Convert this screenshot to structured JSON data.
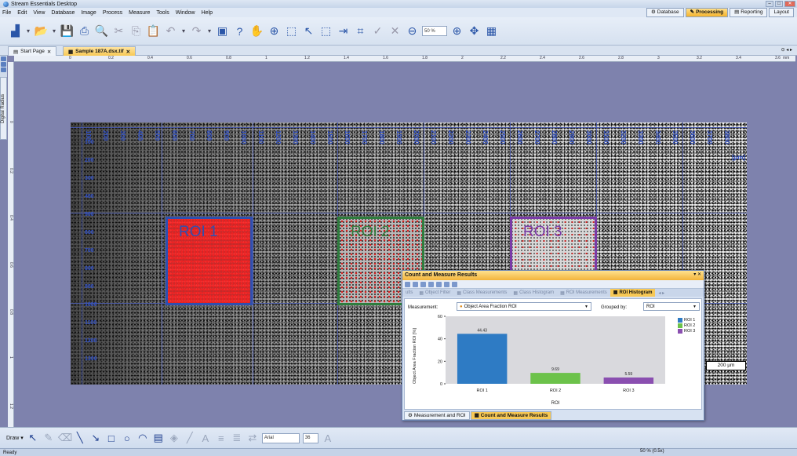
{
  "window": {
    "title": "Stream Essentials Desktop"
  },
  "menu": [
    "File",
    "Edit",
    "View",
    "Database",
    "Image",
    "Process",
    "Measure",
    "Tools",
    "Window",
    "Help"
  ],
  "modes": [
    {
      "label": "Database",
      "active": false
    },
    {
      "label": "Processing",
      "active": true
    },
    {
      "label": "Reporting",
      "active": false
    },
    {
      "label": "Layout",
      "active": false
    }
  ],
  "toolbar": {
    "zoom_value": "50 %"
  },
  "tabs": [
    {
      "label": "Start Page",
      "active": false
    },
    {
      "label": "Sample 187A.dsx.tif",
      "active": true
    }
  ],
  "side_panel": {
    "label": "Digital Radius"
  },
  "ruler_h": {
    "labels": [
      "0",
      "0.2",
      "0.4",
      "0.6",
      "0.8",
      "1",
      "1.2",
      "1.4",
      "1.6",
      "1.8",
      "2",
      "2.2",
      "2.4",
      "2.6",
      "2.8",
      "3",
      "3.2",
      "3.4",
      "3.6",
      "3.8"
    ],
    "unit": "mm"
  },
  "ruler_v": {
    "labels": [
      "0",
      "0.2",
      "0.4",
      "0.6",
      "0.8",
      "1",
      "1.2"
    ]
  },
  "image": {
    "h_marks": [
      "100",
      "200",
      "300",
      "400",
      "500",
      "600",
      "700",
      "800",
      "900",
      "1000",
      "1100",
      "1200",
      "1300",
      "1400",
      "1500",
      "1600",
      "1700",
      "1800",
      "1900",
      "2000",
      "2100",
      "2200",
      "2300",
      "2400",
      "2500",
      "2600",
      "2700",
      "2800",
      "2900",
      "3000",
      "3100",
      "3200",
      "3300",
      "3400",
      "3500",
      "3600",
      "3700",
      "3800"
    ],
    "v_marks": [
      "100",
      "200",
      "300",
      "400",
      "500",
      "600",
      "700",
      "800",
      "900",
      "1000",
      "1100",
      "1200",
      "1300"
    ],
    "unit_label": "[µm]",
    "scale_bar": "200 µm",
    "rois": [
      {
        "label": "ROI 1",
        "color": "#2f4fb0"
      },
      {
        "label": "ROI 2",
        "color": "#2e7d3e"
      },
      {
        "label": "ROI 3",
        "color": "#7a3aa8"
      }
    ]
  },
  "results_panel": {
    "title": "Count and Measure Results",
    "controls": "▾ ✕",
    "tabs": [
      {
        "label": "ults",
        "active": false
      },
      {
        "label": "Object Filter",
        "active": false
      },
      {
        "label": "Class Measurements",
        "active": false
      },
      {
        "label": "Class Histogram",
        "active": false
      },
      {
        "label": "ROI Measurements",
        "active": false
      },
      {
        "label": "ROI Histogram",
        "active": true
      }
    ],
    "measurement_label": "Measurement:",
    "measurement_value": "Object Area Fraction ROI",
    "grouped_label": "Grouped by:",
    "grouped_value": "ROI",
    "bottom_tabs": [
      {
        "label": "Measurement and ROI",
        "active": false
      },
      {
        "label": "Count and Measure Results",
        "active": true
      }
    ]
  },
  "chart_data": {
    "type": "bar",
    "categories": [
      "ROI 1",
      "ROI 2",
      "ROI 3"
    ],
    "values": [
      44.43,
      9.69,
      5.59
    ],
    "value_labels": [
      "44.43",
      "9.69",
      "5.59"
    ],
    "colors": [
      "#2e7bc4",
      "#6cc24a",
      "#8a4fb0"
    ],
    "xlabel": "ROI",
    "ylabel": "Object Area Fraction ROI [%]",
    "ylim": [
      0,
      60
    ],
    "yticks": [
      0,
      20,
      40,
      60
    ],
    "legend": [
      "ROI 1",
      "ROI 2",
      "ROI 3"
    ],
    "legend_position": "right",
    "grid": false
  },
  "drawbar": {
    "draw_label": "Draw",
    "font": "Arial",
    "size": "36"
  },
  "status": {
    "text": "Ready",
    "zoom": "50 % (0.5x)"
  }
}
